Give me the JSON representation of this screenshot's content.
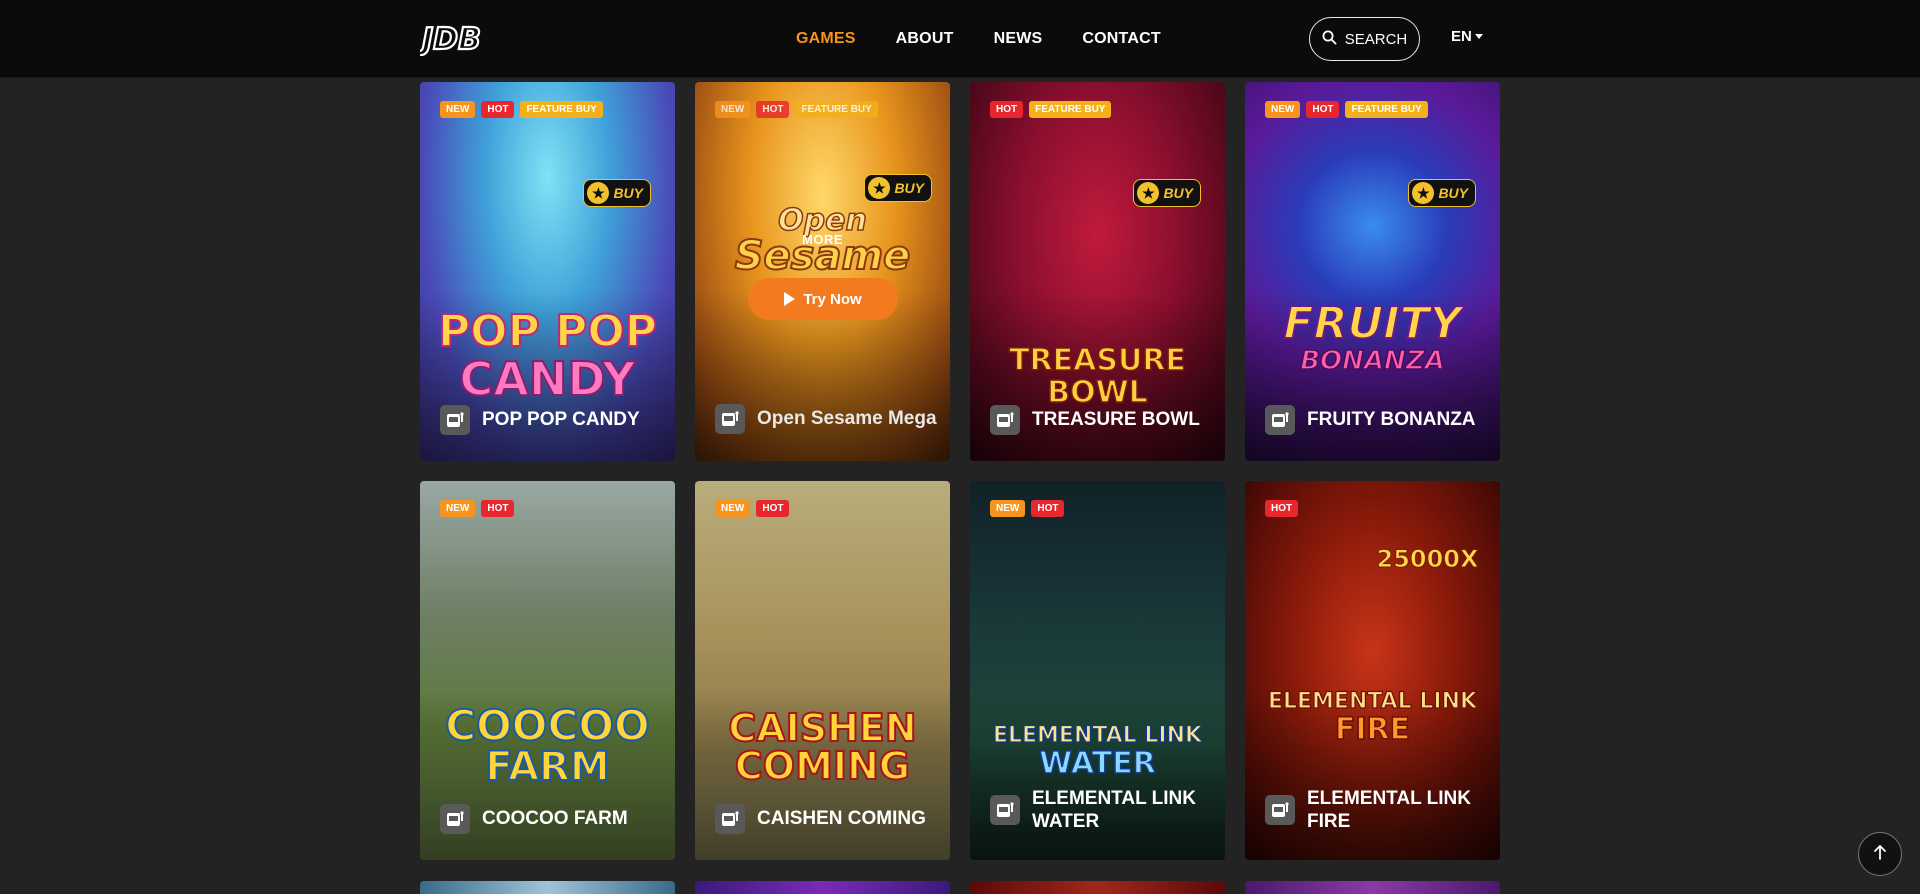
{
  "header": {
    "logo_text": "JDB",
    "nav": [
      {
        "label": "GAMES",
        "active": true
      },
      {
        "label": "ABOUT",
        "active": false
      },
      {
        "label": "NEWS",
        "active": false
      },
      {
        "label": "CONTACT",
        "active": false
      }
    ],
    "search_label": "SEARCH",
    "language": "EN"
  },
  "badge_labels": {
    "new": "NEW",
    "hot": "HOT",
    "feature_buy": "FEATURE BUY"
  },
  "buy_label": "BUY",
  "hover": {
    "more_label": "MORE",
    "try_label": "Try Now"
  },
  "games": [
    {
      "name": "POP POP CANDY",
      "badges": [
        "NEW",
        "HOT",
        "FEATURE BUY"
      ],
      "buy": true,
      "art": [
        "POP POP",
        "CANDY"
      ]
    },
    {
      "name": "Open Sesame Mega",
      "badges": [
        "NEW",
        "HOT",
        "FEATURE BUY"
      ],
      "buy": true,
      "art": [
        "Open",
        "Sesame"
      ],
      "hovered": true
    },
    {
      "name": "TREASURE BOWL",
      "badges": [
        "HOT",
        "FEATURE BUY"
      ],
      "buy": true,
      "art": [
        "TREASURE",
        "BOWL"
      ]
    },
    {
      "name": "FRUITY BONANZA",
      "badges": [
        "NEW",
        "HOT",
        "FEATURE BUY"
      ],
      "buy": true,
      "art": [
        "FRUITY",
        "BONANZA"
      ]
    },
    {
      "name": "COOCOO FARM",
      "badges": [
        "NEW",
        "HOT"
      ],
      "buy": false,
      "art": [
        "COOCOO",
        "FARM"
      ]
    },
    {
      "name": "CAISHEN COMING",
      "badges": [
        "NEW",
        "HOT"
      ],
      "buy": false,
      "art": [
        "CAISHEN",
        "COMING"
      ]
    },
    {
      "name": "ELEMENTAL LINK WATER",
      "badges": [
        "NEW",
        "HOT"
      ],
      "buy": false,
      "art": [
        "ELEMENTAL LINK",
        "WATER"
      ]
    },
    {
      "name": "ELEMENTAL LINK FIRE",
      "badges": [
        "HOT"
      ],
      "buy": false,
      "art": [
        "25000X",
        "ELEMENTAL LINK",
        "FIRE"
      ]
    }
  ],
  "colors": {
    "accent": "#f7941d",
    "new": "#f7941d",
    "hot": "#e8262e",
    "feature_buy": "#f3b01a",
    "header_bg": "#0b0b0b",
    "page_bg": "#232323"
  },
  "icons": {
    "search": "search-icon",
    "slot": "slot-machine-icon",
    "star": "star-icon",
    "play": "play-icon",
    "back_to_top": "arrow-up-icon"
  }
}
